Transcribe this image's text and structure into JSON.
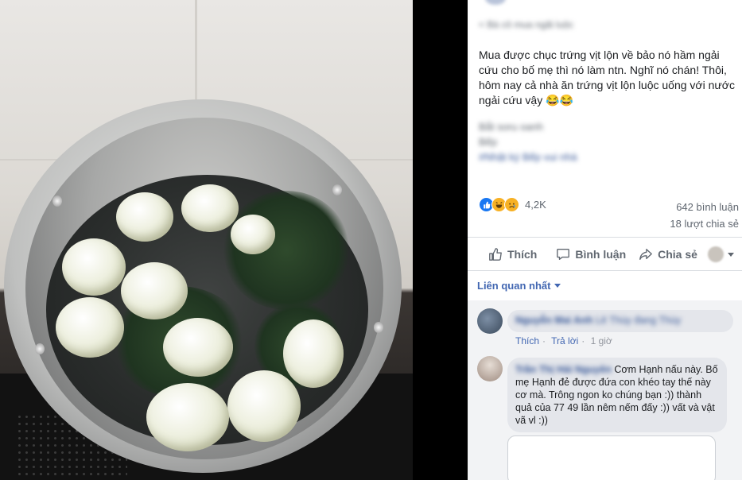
{
  "post": {
    "author_blurred": "Nguyễn Thị",
    "subline_blurred": "< Bà cô mua ngãi luộc",
    "text": "Mua được chục trứng vịt lộn về bảo nó hầm ngải cứu cho bố mẹ thì nó làm ntn. Nghĩ nó chán! Thôi, hôm nay cả nhà ăn trứng vịt lộn luộc uống với nước ngải cứu vậy 😂😂",
    "blurred_lines": [
      "Bắt soru oanh",
      "Bếp",
      "#Nhật ký Bếp vui nhà"
    ]
  },
  "reactions": {
    "count": "4,2K",
    "comments": "642 bình luận",
    "shares": "18 lượt chia sẻ"
  },
  "actions": {
    "like": "Thích",
    "comment": "Bình luận",
    "share": "Chia sẻ"
  },
  "sort": {
    "label": "Liên quan nhất"
  },
  "comments": [
    {
      "name_blurred": "Nguyễn Mai Anh",
      "text_blurred": "Lê Thùy đang Thùy",
      "like": "Thích",
      "reply": "Trả lời",
      "time": "1 giờ"
    },
    {
      "name_blurred": "Trần Thị Hải Nguyên",
      "text": "Cơm Hạnh nấu này. Bố mẹ Hạnh đẻ được đứa con khéo tay thế này cơ mà. Trông ngon ko chúng bạn :)) thành quả của 77 49 lần nêm nếm đấy :)) vất và vật vã vl :))"
    }
  ],
  "colors": {
    "link": "#4267b2",
    "muted": "#606770",
    "like_blue": "#1877f2",
    "haha_yellow": "#f7b125"
  }
}
